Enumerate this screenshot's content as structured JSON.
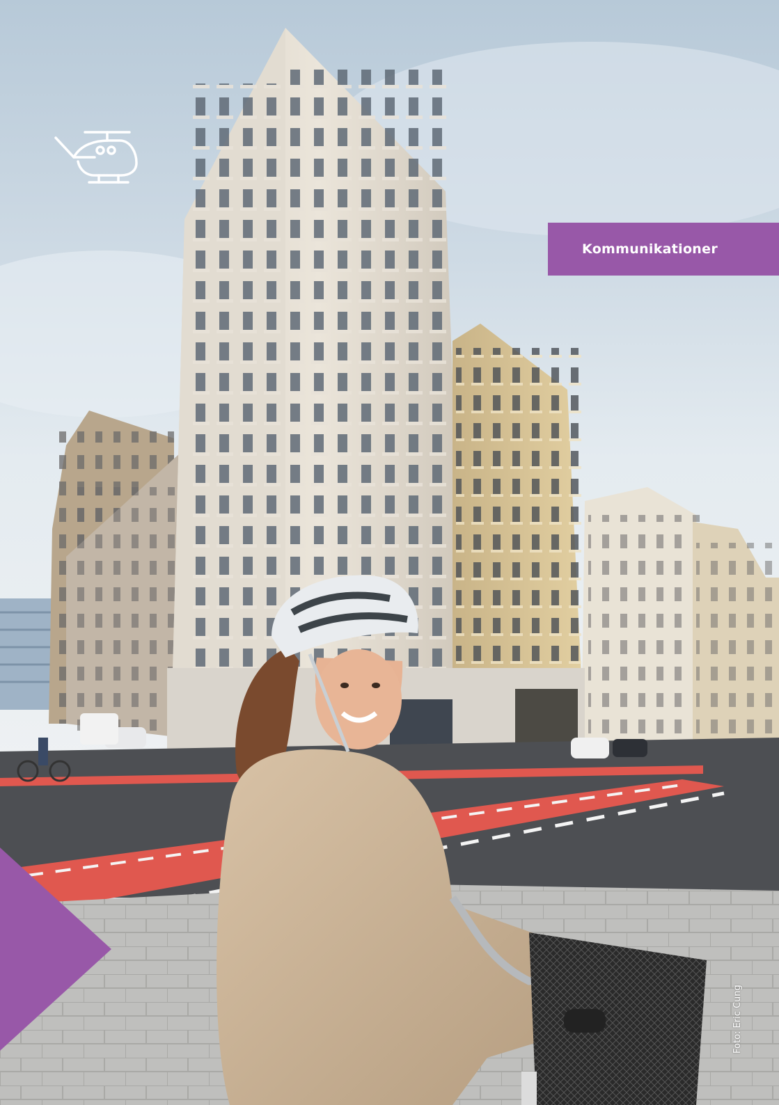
{
  "section": {
    "label": "Kommunikationer",
    "color": "#9858a8"
  },
  "icons": {
    "top_left": "helicopter-icon"
  },
  "photo": {
    "credit": "Foto: Eric Cung"
  },
  "colors": {
    "accent": "#9858a8",
    "bike_lane": "#e0584f"
  }
}
